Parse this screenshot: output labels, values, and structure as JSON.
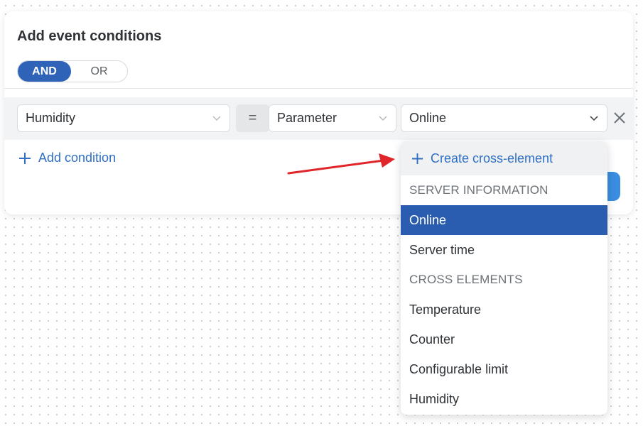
{
  "panel": {
    "title": "Add event conditions",
    "logic_toggle": {
      "and_label": "AND",
      "or_label": "OR",
      "selected": "AND"
    }
  },
  "condition": {
    "element_value": "Humidity",
    "operator_symbol": "=",
    "type_value": "Parameter",
    "parameter_value": "Online"
  },
  "add_condition_label": "Add condition",
  "dropdown": {
    "create_label": "Create cross-element",
    "groups": [
      {
        "header": "SERVER INFORMATION",
        "options": [
          "Online",
          "Server time"
        ]
      },
      {
        "header": "CROSS ELEMENTS",
        "options": [
          "Temperature",
          "Counter",
          "Configurable limit",
          "Humidity"
        ]
      }
    ],
    "selected": "Online"
  },
  "colors": {
    "primary": "#2f63b8",
    "link": "#2f6fc4",
    "annotation_arrow": "#e0262b"
  },
  "icons": [
    "chevron-down-icon",
    "close-icon",
    "plus-icon",
    "annotation-arrow"
  ]
}
